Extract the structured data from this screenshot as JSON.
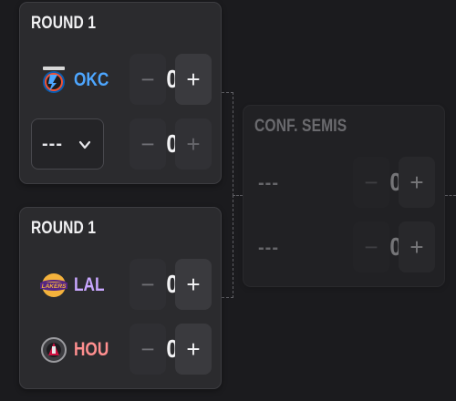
{
  "colors": {
    "background": "#1b1b1e",
    "card": "#2b2b2e",
    "okc": "#4da6ff",
    "lal": "#c9a7ff",
    "hou": "#ff8f8f"
  },
  "bracket": [
    {
      "title": "ROUND 1",
      "teams": [
        {
          "abbr": "OKC",
          "score": "0",
          "logo": "thunder-logo",
          "minus": "−",
          "plus": "+"
        },
        {
          "select_value": "---",
          "score": "0",
          "minus": "−",
          "plus": "+"
        }
      ]
    },
    {
      "title": "ROUND 1",
      "teams": [
        {
          "abbr": "LAL",
          "score": "0",
          "logo": "lakers-logo",
          "minus": "−",
          "plus": "+"
        },
        {
          "abbr": "HOU",
          "score": "0",
          "logo": "rockets-logo",
          "minus": "−",
          "plus": "+"
        }
      ]
    },
    {
      "title": "CONF. SEMIS",
      "teams": [
        {
          "placeholder": "---",
          "score": "0",
          "minus": "−",
          "plus": "+"
        },
        {
          "placeholder": "---",
          "score": "0",
          "minus": "−",
          "plus": "+"
        }
      ]
    }
  ]
}
